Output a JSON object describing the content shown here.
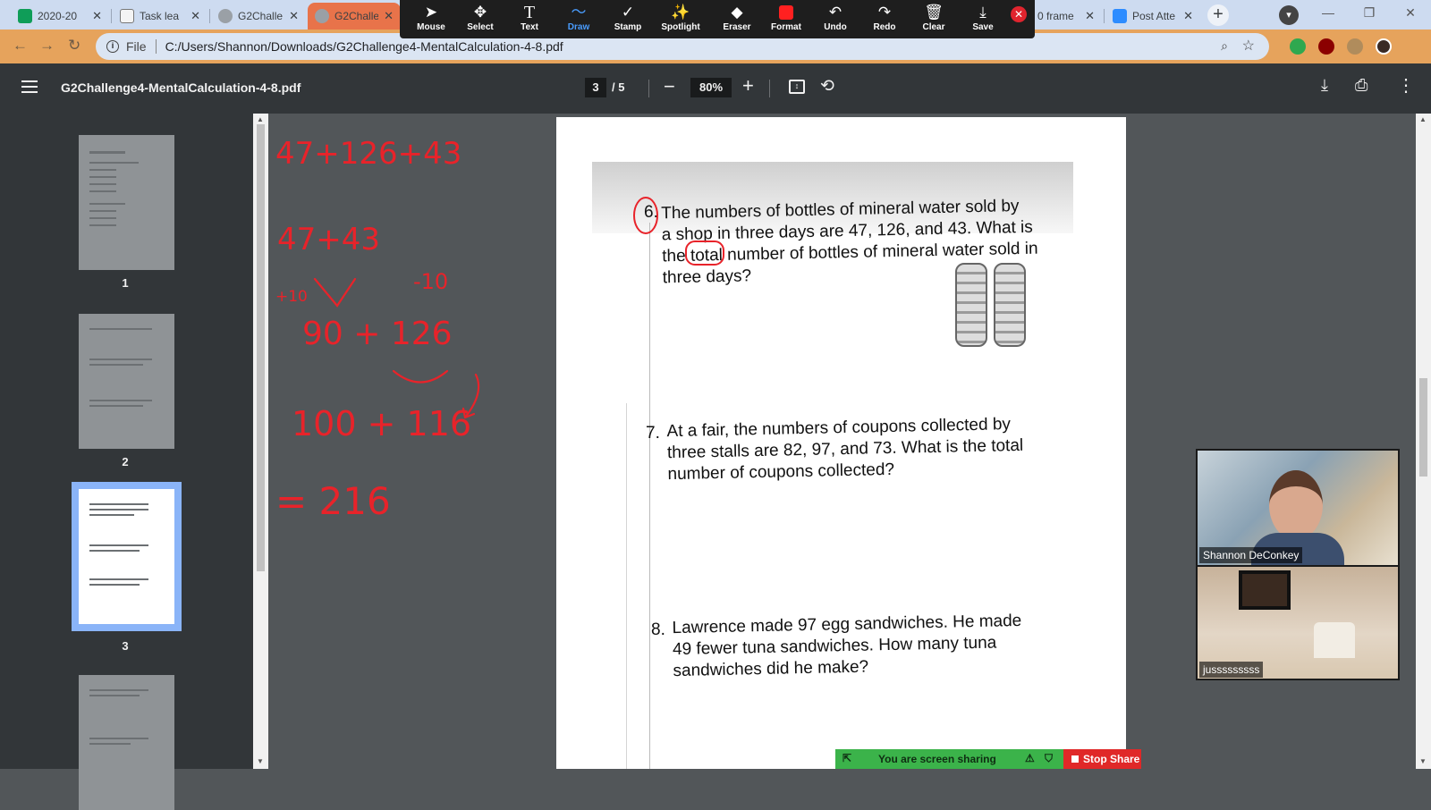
{
  "browser": {
    "tabs": [
      {
        "title": "2020-20",
        "color": "#0f9d58"
      },
      {
        "title": "Task lea",
        "color": "#f4f4f4"
      },
      {
        "title": "G2Challe",
        "color": "#9aa0a6"
      },
      {
        "title": "G2Challe",
        "color": "#9aa0a6"
      },
      {
        "title": "0 frame",
        "color": "#cddbf0"
      },
      {
        "title": "Post Atte",
        "color": "#2d8cff"
      }
    ],
    "url_scheme": "File",
    "url": "C:/Users/Shannon/Downloads/G2Challenge4-MentalCalculation-4-8.pdf"
  },
  "annotation_toolbar": {
    "tools": [
      {
        "label": "Mouse",
        "icon": "➤"
      },
      {
        "label": "Select",
        "icon": "✥"
      },
      {
        "label": "Text",
        "icon": "T"
      },
      {
        "label": "Draw",
        "icon": "〜"
      },
      {
        "label": "Stamp",
        "icon": "✓"
      },
      {
        "label": "Spotlight",
        "icon": "✨"
      },
      {
        "label": "Eraser",
        "icon": "◆"
      },
      {
        "label": "Format",
        "icon": ""
      },
      {
        "label": "Undo",
        "icon": "↶"
      },
      {
        "label": "Redo",
        "icon": "↷"
      },
      {
        "label": "Clear",
        "icon": "🗑"
      },
      {
        "label": "Save",
        "icon": "⤓"
      }
    ],
    "format_color": "#ff2020"
  },
  "pdf": {
    "filename": "G2Challenge4-MentalCalculation-4-8.pdf",
    "current_page": "3",
    "total_pages": "/ 5",
    "zoom": "80%",
    "thumbnails": [
      "1",
      "2",
      "3"
    ]
  },
  "handwriting": {
    "line1": "47+126+43",
    "line2": "47+43",
    "plus10": "+10",
    "minus10": "-10",
    "line3": "90 + 126",
    "line4": "100 + 116",
    "result": "= 216",
    "ink_color": "#e8232a"
  },
  "questions": [
    {
      "num": "6.",
      "lines": [
        "The numbers of bottles of mineral water sold by",
        "a shop in three days are 47, 126, and 43. What is",
        "the total number of bottles of mineral water sold in",
        "three days?"
      ]
    },
    {
      "num": "7.",
      "lines": [
        "At a fair, the numbers of coupons collected by",
        "three stalls are 82, 97, and 73. What is the total",
        "number of coupons collected?"
      ]
    },
    {
      "num": "8.",
      "lines": [
        "Lawrence made 97 egg sandwiches. He made",
        "49 fewer tuna sandwiches. How many tuna",
        "sandwiches did he make?"
      ]
    }
  ],
  "zoom_video": {
    "participant1": "Shannon DeConkey",
    "participant2": "jusssssssss"
  },
  "share": {
    "status": "You are screen sharing",
    "stop": "Stop Share"
  }
}
